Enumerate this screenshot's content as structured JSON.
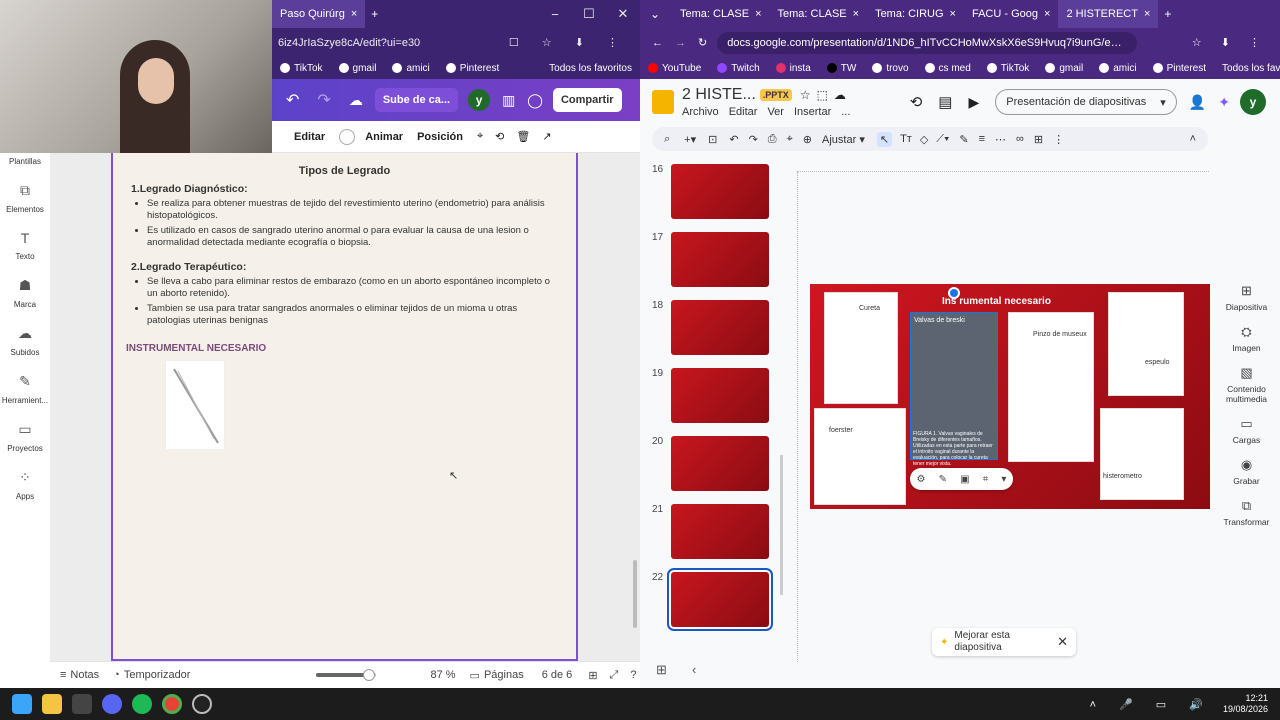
{
  "webcam": {
    "description_icon": "webcam-feed"
  },
  "left": {
    "tabs": [
      {
        "label": "Paso Quirúrg",
        "close": "×"
      }
    ],
    "new_tab": "+",
    "window_controls": [
      "−",
      "☐",
      "✕"
    ],
    "address": "6iz4JrIaSzye8cA/edit?ui=e30",
    "bookmarks": [
      "TikTok",
      "gmail",
      "amici",
      "Pinterest"
    ],
    "bookmarks_all": "Todos los favoritos",
    "toolbar": {
      "upload": "Sube de ca...",
      "avatar": "y",
      "share": "Compartir"
    },
    "edit_toolbar": {
      "edit": "Editar",
      "animate": "Animar",
      "position": "Posición"
    },
    "sidebar": [
      "Plantillas",
      "Elementos",
      "Texto",
      "Marca",
      "Subidos",
      "Herramient...",
      "Proyectos",
      "Apps"
    ],
    "page": {
      "title": "Tipos de Legrado",
      "section1": "1.Legrado Diagnóstico:",
      "bullets1": [
        "Se realiza para obtener muestras de tejido del revestimiento uterino (endometrio) para análisis histopatológicos.",
        "Es utilizado en casos de sangrado uterino anormal o para evaluar la causa de una lesion o anormalidad detectada mediante ecografía o biopsia."
      ],
      "section2": "2.Legrado Terapéutico:",
      "bullets2": [
        "Se lleva a cabo para eliminar restos de embarazo (como en un aborto espontáneo incompleto o un aborto retenido).",
        "Tambien se usa para tratar sangrados anormales o eliminar tejidos de un mioma u otras patologias uterinas benignas"
      ],
      "instrumental": "INSTRUMENTAL NECESARIO"
    },
    "footer": {
      "notes": "Notas",
      "timer": "Temporizador",
      "zoom": "87 %",
      "zoom_fraction": 0.87,
      "pages": "Páginas",
      "page_count": "6 de 6"
    }
  },
  "right": {
    "tabs": [
      {
        "label": "Tema: CLASE",
        "close": "×"
      },
      {
        "label": "Tema: CLASE",
        "close": "×"
      },
      {
        "label": "Tema: CIRUG",
        "close": "×"
      },
      {
        "label": "FACU - Goog",
        "close": "×"
      },
      {
        "label": "2 HISTERECT",
        "close": "×"
      }
    ],
    "new_tab": "+",
    "address": "docs.google.com/presentation/d/1ND6_hITvCCHoMwXskX6eS9Hvuq7i9unG/edit?slide=...",
    "bookmarks": [
      "YouTube",
      "Twitch",
      "insta",
      "TW",
      "trovo",
      "cs med",
      "TikTok",
      "gmail",
      "amici",
      "Pinterest"
    ],
    "bookmarks_all": "Todos los favoritos",
    "doc": {
      "title": "2 HISTE...",
      "badge": ".PPTX",
      "menus": [
        "Archivo",
        "Editar",
        "Ver",
        "Insertar",
        "..."
      ]
    },
    "present": "Presentación de diapositivas",
    "avatar": "y",
    "toolbar": {
      "fit": "Ajustar"
    },
    "slides": [
      "16",
      "17",
      "18",
      "19",
      "20",
      "21",
      "22"
    ],
    "slide": {
      "title": "Ins rumental necesario",
      "labels": [
        "Cureta",
        "Valvas de breski",
        "Pinzo de museux",
        "espeulo",
        "foerster",
        "histerometro"
      ],
      "caption": "FIGURA 1. Valvas vaginales de Breisky de diferentes tamaños. Utilizadas en esta parte para retraer el introito vaginal durante la evaluación, para colocar la cureta tener mejor vista."
    },
    "rsidebar": [
      "Diapositiva",
      "Imagen",
      "Contenido multimedia",
      "Cargas",
      "Grabar",
      "Transformar"
    ],
    "tip": "Mejorar esta diapositiva"
  },
  "taskbar": {
    "time": "12:21",
    "date": "19/08/2026"
  }
}
